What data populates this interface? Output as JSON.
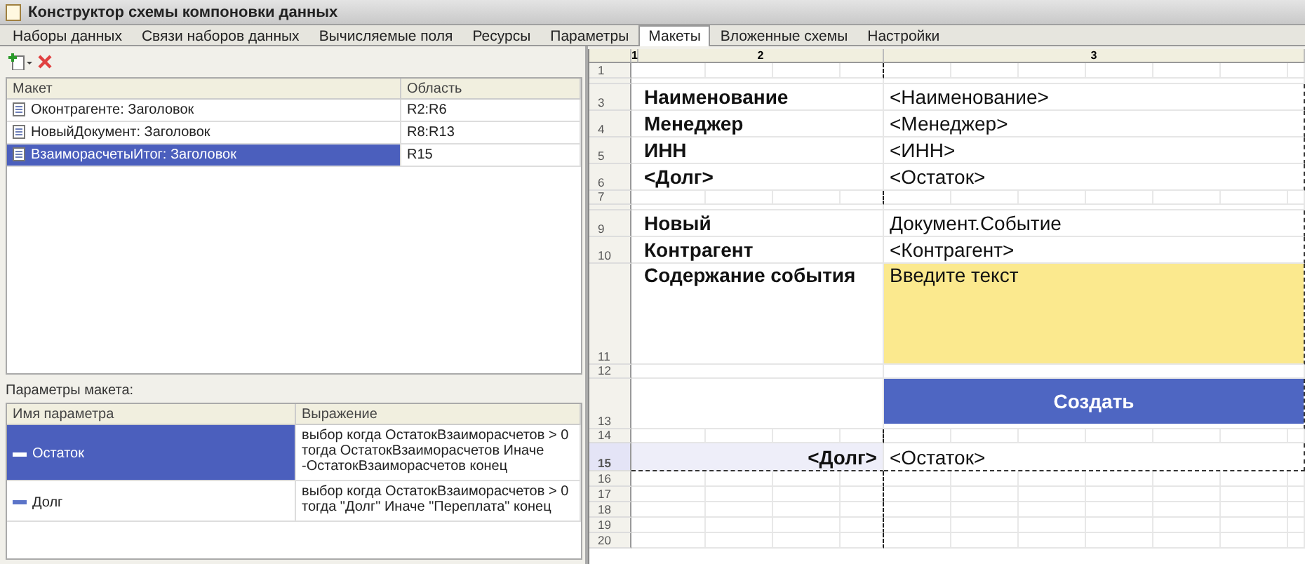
{
  "window": {
    "title": "Конструктор схемы компоновки данных"
  },
  "tabs": [
    {
      "label": "Наборы данных",
      "selected": false
    },
    {
      "label": "Связи наборов данных",
      "selected": false
    },
    {
      "label": "Вычисляемые поля",
      "selected": false
    },
    {
      "label": "Ресурсы",
      "selected": false
    },
    {
      "label": "Параметры",
      "selected": false
    },
    {
      "label": "Макеты",
      "selected": true
    },
    {
      "label": "Вложенные схемы",
      "selected": false
    },
    {
      "label": "Настройки",
      "selected": false
    }
  ],
  "layouts": {
    "columns": [
      "Макет",
      "Область"
    ],
    "rows": [
      {
        "name": "Оконтрагенте: Заголовок",
        "area": "R2:R6",
        "selected": false
      },
      {
        "name": "НовыйДокумент: Заголовок",
        "area": "R8:R13",
        "selected": false
      },
      {
        "name": "ВзаиморасчетыИтог: Заголовок",
        "area": "R15",
        "selected": true
      }
    ]
  },
  "parameters": {
    "label": "Параметры макета:",
    "columns": [
      "Имя параметра",
      "Выражение"
    ],
    "rows": [
      {
        "name": "Остаток",
        "expression": "выбор когда  ОстатокВзаиморасчетов > 0 тогда ОстатокВзаиморасчетов Иначе -ОстатокВзаиморасчетов конец",
        "selected": true
      },
      {
        "name": "Долг",
        "expression": "выбор когда  ОстатокВзаиморасчетов > 0 тогда \"Долг\" Иначе \"Переплата\" конец",
        "selected": false
      }
    ]
  },
  "sheet": {
    "columns": [
      "1",
      "2",
      "3"
    ],
    "rows": [
      {
        "number": "1",
        "kind": "empty",
        "selected": false
      },
      {
        "kind": "gap",
        "selected": false
      },
      {
        "number": "3",
        "kind": "field",
        "label": "Наименование",
        "value": "<Наименование>",
        "selected": false
      },
      {
        "number": "4",
        "kind": "field",
        "label": "Менеджер",
        "value": "<Менеджер>",
        "selected": false
      },
      {
        "number": "5",
        "kind": "field",
        "label": "ИНН",
        "value": "<ИНН>",
        "selected": false
      },
      {
        "number": "6",
        "kind": "field",
        "label": "<Долг>",
        "value": "<Остаток>",
        "selected": false
      },
      {
        "number": "7",
        "kind": "spacer",
        "selected": false
      },
      {
        "kind": "gap",
        "selected": false
      },
      {
        "number": "9",
        "kind": "field",
        "label": "Новый",
        "value": "Документ.Событие",
        "selected": false
      },
      {
        "number": "10",
        "kind": "field",
        "label": "Контрагент",
        "value": "<Контрагент>",
        "selected": false
      },
      {
        "number": "11",
        "kind": "input",
        "label": "Содержание события",
        "value": "Введите текст",
        "selected": false
      },
      {
        "number": "12",
        "kind": "thin",
        "selected": false
      },
      {
        "number": "13",
        "kind": "button",
        "value": "Создать",
        "selected": false
      },
      {
        "number": "14",
        "kind": "spacer",
        "selected": false
      },
      {
        "number": "15",
        "kind": "total",
        "label": "<Долг>",
        "value": "<Остаток>",
        "selected": true
      },
      {
        "number": "16",
        "kind": "empty",
        "selected": false
      },
      {
        "number": "17",
        "kind": "empty",
        "selected": false
      },
      {
        "number": "18",
        "kind": "empty",
        "selected": false
      },
      {
        "number": "19",
        "kind": "empty",
        "selected": false
      },
      {
        "number": "20",
        "kind": "empty",
        "selected": false
      }
    ]
  }
}
